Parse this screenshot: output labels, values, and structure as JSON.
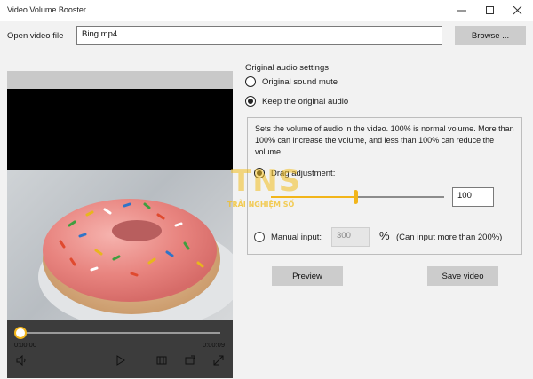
{
  "window": {
    "title": "Video Volume Booster",
    "controls": [
      "minimize",
      "maximize",
      "close"
    ]
  },
  "file": {
    "label": "Open video file",
    "value": "Bing.mp4",
    "browse_label": "Browse ..."
  },
  "player": {
    "time_current": "0:00:00",
    "time_total": "0:00:09",
    "progress": 0.0
  },
  "audio": {
    "section_label": "Original audio settings",
    "option_mute": "Original sound mute",
    "option_keep": "Keep the original audio",
    "selected": "keep",
    "description": "Sets the volume of audio in the video. 100% is normal volume. More than 100% can increase the volume, and less than 100% can reduce the volume.",
    "drag_label": "Drag adjustment:",
    "slider_value": "100",
    "slider_fraction": 0.5,
    "manual_label": "Manual input:",
    "manual_placeholder": "300",
    "percent_sign": "%",
    "manual_hint": "(Can input more than 200%)",
    "mode": "drag"
  },
  "actions": {
    "preview_label": "Preview",
    "save_label": "Save video"
  },
  "watermark": {
    "logo": "TNS",
    "tagline": "TRẢI NGHIỆM SỐ"
  },
  "colors": {
    "accent_yellow": "#f2b51a",
    "button_gray": "#cccccc",
    "background": "#f2f2f2"
  }
}
